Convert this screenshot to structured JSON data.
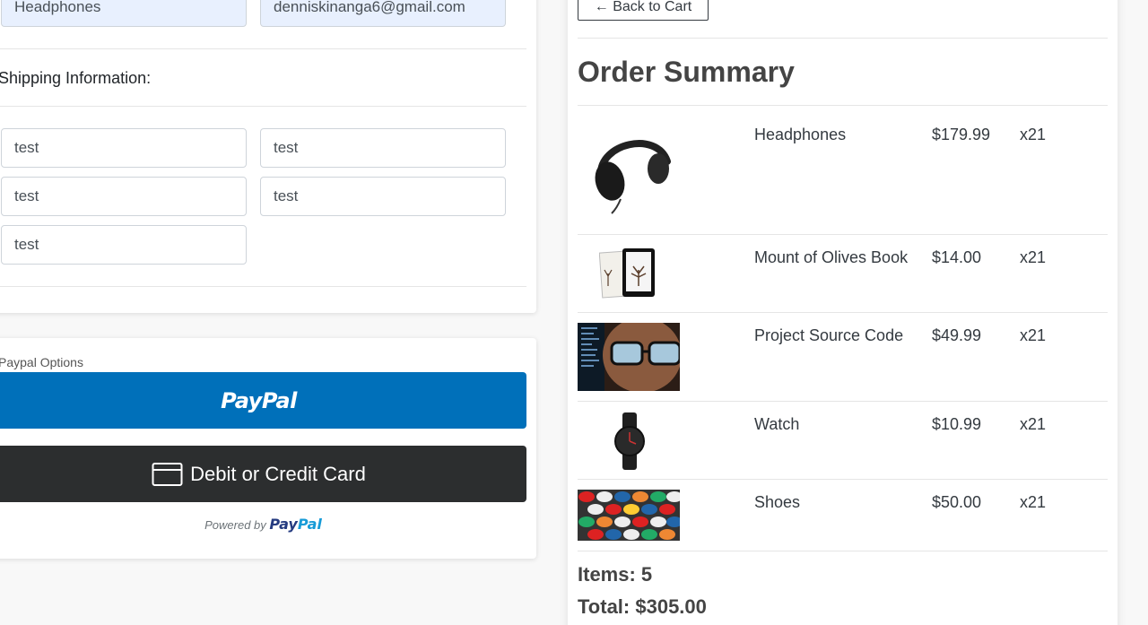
{
  "billing": {
    "name_value": "Headphones",
    "email_value": "denniskinanga6@gmail.com"
  },
  "shipping": {
    "label": "Shipping Information:",
    "address": "test",
    "city": "test",
    "state": "test",
    "zipcode": "test",
    "country": "test"
  },
  "paypal": {
    "label": "Paypal Options",
    "paypal_button": "PayPal",
    "card_button": "Debit or Credit Card",
    "powered_by": "Powered by",
    "powered_pay": "Pay",
    "powered_pal": "Pal"
  },
  "summary": {
    "back_label": "← Back to Cart",
    "title": "Order Summary",
    "items": [
      {
        "name": "Headphones",
        "price": "$179.99",
        "qty": "x21"
      },
      {
        "name": "Mount of Olives Book",
        "price": "$14.00",
        "qty": "x21"
      },
      {
        "name": "Project Source Code",
        "price": "$49.99",
        "qty": "x21"
      },
      {
        "name": "Watch",
        "price": "$10.99",
        "qty": "x21"
      },
      {
        "name": "Shoes",
        "price": "$50.00",
        "qty": "x21"
      }
    ],
    "items_count": "Items: 5",
    "total": "Total: $305.00"
  },
  "icons": {
    "card": "credit-card-icon"
  }
}
